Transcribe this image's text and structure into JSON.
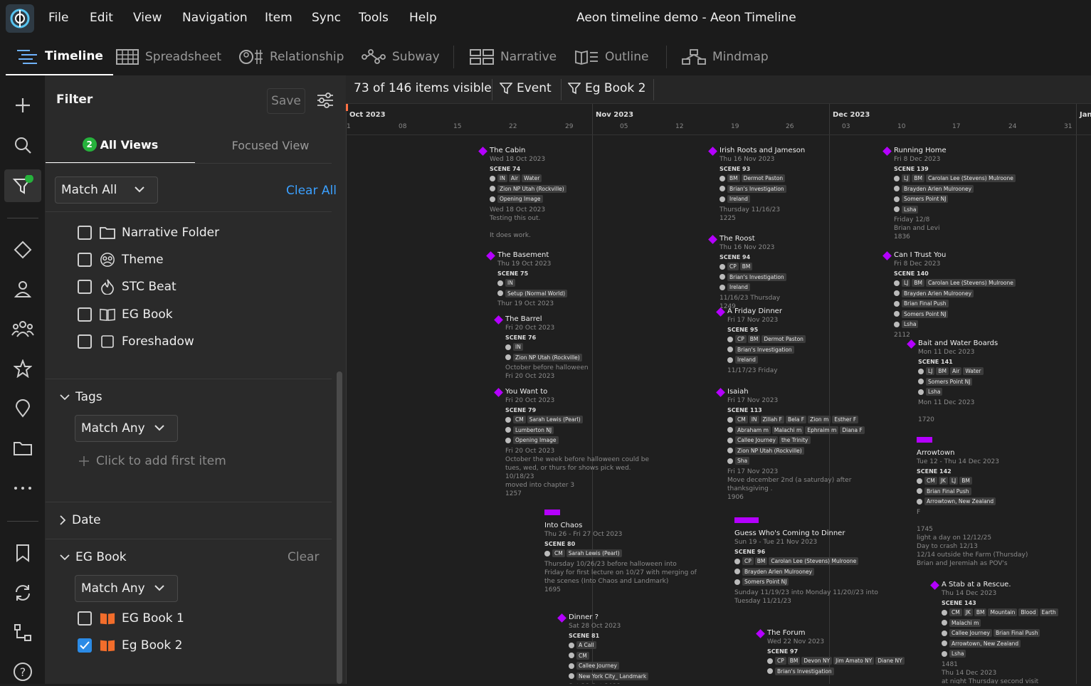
{
  "app": {
    "window_title": "Aeon timeline demo - Aeon Timeline",
    "logo_icon": "aeon-logo-icon"
  },
  "menu": [
    "File",
    "Edit",
    "View",
    "Navigation",
    "Item",
    "Sync",
    "Tools",
    "Help"
  ],
  "view_tabs": [
    {
      "label": "Timeline",
      "icon": "timeline-icon"
    },
    {
      "label": "Spreadsheet",
      "icon": "spreadsheet-icon"
    },
    {
      "label": "Relationship",
      "icon": "relationship-icon"
    },
    {
      "label": "Subway",
      "icon": "subway-icon"
    },
    {
      "label": "Narrative",
      "icon": "narrative-icon"
    },
    {
      "label": "Outline",
      "icon": "outline-icon"
    },
    {
      "label": "Mindmap",
      "icon": "mindmap-icon"
    }
  ],
  "filter": {
    "title": "Filter",
    "save_label": "Save",
    "tabs": {
      "all_views": "All Views",
      "badge": "2",
      "focused_view": "Focused View"
    },
    "match_all": "Match All",
    "clear_all": "Clear All",
    "types": [
      {
        "label": "Narrative Folder",
        "icon": "folder-icon"
      },
      {
        "label": "Theme",
        "icon": "theme-icon"
      },
      {
        "label": "STC Beat",
        "icon": "stc-beat-icon"
      },
      {
        "label": "EG Book",
        "icon": "book-icon"
      },
      {
        "label": "Foreshadow",
        "icon": "foreshadow-icon"
      }
    ],
    "tags": {
      "title": "Tags",
      "match": "Match Any",
      "add_first": "Click to add first item"
    },
    "date": {
      "title": "Date"
    },
    "eg_book": {
      "title": "EG Book",
      "clear": "Clear",
      "match": "Match Any",
      "items": [
        {
          "label": "EG Book 1",
          "checked": false
        },
        {
          "label": "Eg Book 2",
          "checked": true
        }
      ]
    }
  },
  "filterbar": {
    "visible": "73 of 146 items visible",
    "chips": [
      "Event",
      "Eg Book 2"
    ]
  },
  "timeline": {
    "months": [
      "Oct 2023",
      "Nov 2023",
      "Dec 2023",
      "Jan"
    ],
    "days": [
      "1",
      "08",
      "15",
      "22",
      "29",
      "05",
      "12",
      "19",
      "26",
      "03",
      "10",
      "17",
      "24",
      "31"
    ],
    "events": [
      {
        "title": "The Cabin",
        "date": "Wed 18 Oct 2023",
        "scene": "SCENE 74",
        "tags": [
          [
            "IN",
            "Air",
            "Water"
          ],
          [
            "Zion NP Utah (Rockville)"
          ],
          [
            "Opening Image"
          ]
        ],
        "notes": "Wed 18 Oct 2023\nTesting this out.\n\nIt does work."
      },
      {
        "title": "The Basement",
        "date": "Thu 19 Oct 2023",
        "scene": "SCENE 75",
        "tags": [
          [
            "IN"
          ],
          [
            "Setup (Normal World)"
          ]
        ],
        "notes": "Thur 19 Oct 2023"
      },
      {
        "title": "The Barrel",
        "date": "Fri 20 Oct 2023",
        "scene": "SCENE 76",
        "tags": [
          [
            "IN"
          ],
          [
            "Zion NP Utah (Rockville)"
          ]
        ],
        "notes": "October before halloween\nFri 20 Oct 2023"
      },
      {
        "title": "You Want to",
        "date": "Fri 20 Oct 2023",
        "scene": "SCENE 79",
        "tags": [
          [
            "CM",
            "Sarah Lewis (Pearl)"
          ],
          [
            "Lumberton NJ"
          ],
          [
            "Opening Image"
          ]
        ],
        "notes": "Fri 20 Oct 2023\nOctober the week before halloween could be\ntues, wed, or thurs for shows pick wed.\n10/18/23\nmoved into chapter 3\n1257"
      },
      {
        "title": "Into Chaos",
        "date": "Thu 26 - Fri 27 Oct 2023",
        "scene": "SCENE 80",
        "tags": [
          [
            "CM",
            "Sarah Lewis (Pearl)"
          ]
        ],
        "notes": "Thursday 10/26/23 before halloween into\nFriday for first lecture on 10/27 with merging of\nthe scenes (Into Chaos and Landmark)\n1695"
      },
      {
        "title": "Dinner ?",
        "date": "Sat 28 Oct 2023",
        "scene": "SCENE 81",
        "tags": [
          [
            "A Call"
          ],
          [
            "CM"
          ],
          [
            "Callee Journey"
          ],
          [
            "New York City_ Landmark"
          ]
        ],
        "notes": "Sat 28 Oct 2023"
      },
      {
        "title": "Irish Roots and Jameson",
        "date": "Thu 16 Nov 2023",
        "scene": "SCENE 93",
        "tags": [
          [
            "BM",
            "Dermot Paston"
          ],
          [
            "Brian's Investigation"
          ],
          [
            "Ireland"
          ]
        ],
        "notes": "Thursday 11/16/23\n1225"
      },
      {
        "title": "The Roost",
        "date": "Thu 16 Nov 2023",
        "scene": "SCENE 94",
        "tags": [
          [
            "CP",
            "BM"
          ],
          [
            "Brian's Investigation"
          ],
          [
            "Ireland"
          ]
        ],
        "notes": "11/16/23 Thursday\n1249"
      },
      {
        "title": "A Friday Dinner",
        "date": "Fri 17 Nov 2023",
        "scene": "SCENE 95",
        "tags": [
          [
            "CP",
            "BM",
            "Dermot Paston"
          ],
          [
            "Brian's Investigation"
          ],
          [
            "Ireland"
          ]
        ],
        "notes": "11/17/23 Friday"
      },
      {
        "title": "Isaiah",
        "date": "Fri 17 Nov 2023",
        "scene": "SCENE 113",
        "tags": [
          [
            "CM",
            "IN",
            "Zillah F",
            "Bela F",
            "Zion m",
            "Esther F"
          ],
          [
            "Abraham m",
            "Malachi m",
            "Ephraim m",
            "Diana F"
          ],
          [
            "Callee Journey",
            "the Trinity"
          ],
          [
            "Zion NP Utah (Rockville)"
          ],
          [
            "Sha"
          ]
        ],
        "notes": "Fri 17 Nov 2023\nMove december 2nd (a saturday) after\nthanksgiving .\n1906"
      },
      {
        "title": "Guess Who's Coming to Dinner",
        "date": "Sun 19 - Tue 21 Nov 2023",
        "scene": "SCENE 96",
        "tags": [
          [
            "CP",
            "BM",
            "Carolan Lee (Stevens) Mulroone"
          ],
          [
            "Brayden Arlen Mulrooney"
          ],
          [
            "Somers Point NJ"
          ]
        ],
        "notes": "Sunday 11/19/23 into Monday 11/20//23 into\nTuesday 11/21/23"
      },
      {
        "title": "The Forum",
        "date": "Wed 22 Nov 2023",
        "scene": "SCENE 97",
        "tags": [
          [
            "CP",
            "BM",
            "Devon NY",
            "Jim Amato NY",
            "Diane NY"
          ],
          [
            "Brian's Investigation"
          ]
        ],
        "notes": ""
      },
      {
        "title": "Running Home",
        "date": "Fri 8 Dec 2023",
        "scene": "SCENE 139",
        "tags": [
          [
            "LJ",
            "BM",
            "Carolan Lee (Stevens) Mulroone"
          ],
          [
            "Brayden Arlen Mulrooney"
          ],
          [
            "Somers Point NJ"
          ],
          [
            "Lsha"
          ]
        ],
        "notes": "Friday 12/8\nBrian and Levi\n1836"
      },
      {
        "title": "Can I Trust You",
        "date": "Fri 8 Dec 2023",
        "scene": "SCENE 140",
        "tags": [
          [
            "LJ",
            "BM",
            "Carolan Lee (Stevens) Mulroone"
          ],
          [
            "Brayden Arlen Mulrooney"
          ],
          [
            "Brian Final Push"
          ],
          [
            "Somers Point NJ"
          ],
          [
            "Lsha"
          ]
        ],
        "notes": "2112"
      },
      {
        "title": "Bait and Water Boards",
        "date": "Mon 11 Dec 2023",
        "scene": "SCENE 141",
        "tags": [
          [
            "LJ",
            "BM",
            "Air",
            "Water"
          ],
          [
            "Somers Point NJ"
          ],
          [
            "Lsha"
          ]
        ],
        "notes": "Mon 11 Dec 2023\n\n1720"
      },
      {
        "title": "Arrowtown",
        "date": "Tue 12 - Thu 14 Dec 2023",
        "scene": "SCENE 142",
        "tags": [
          [
            "CM",
            "JK",
            "LJ",
            "BM"
          ],
          [
            "Brian Final Push"
          ],
          [
            "Arrowtown, New Zealand"
          ]
        ],
        "notes": "F\n\n1745\nlight a day on 12/12/25\nDay to crash 12/13\n12/14 outside the Farm (Thursday)\nBrian and Jeremiah as POV's"
      },
      {
        "title": "A Stab at a Rescue.",
        "date": "Thu 14 Dec 2023",
        "scene": "SCENE 143",
        "tags": [
          [
            "CM",
            "JK",
            "BM",
            "Mountain",
            "Blood",
            "Earth"
          ],
          [
            "Malachi m"
          ],
          [
            "Callee Journey",
            "Brian Final Push"
          ],
          [
            "Arrowtown, New Zealand"
          ],
          [
            "Lsha"
          ]
        ],
        "notes": "1481\nThu 14 Dec 2023\nat night Thursday second visit"
      }
    ]
  },
  "colors": {
    "event_purple": "#b400ff",
    "accent_blue": "#3ba0ff",
    "badge_green": "#26b23c",
    "book_orange": "#f26d2b"
  }
}
